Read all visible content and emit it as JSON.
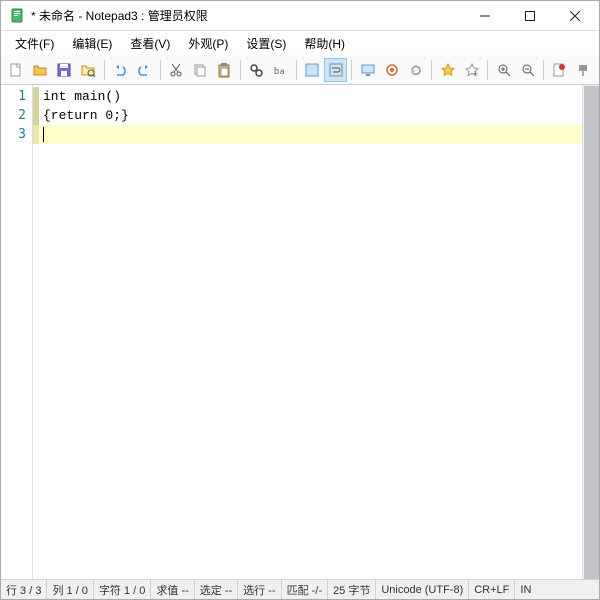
{
  "title": "* 未命名 - Notepad3 : 管理员权限",
  "menu": [
    {
      "label": "文件(F)"
    },
    {
      "label": "编辑(E)"
    },
    {
      "label": "查看(V)"
    },
    {
      "label": "外观(P)"
    },
    {
      "label": "设置(S)"
    },
    {
      "label": "帮助(H)"
    }
  ],
  "code": {
    "lines": [
      {
        "n": "1",
        "text": "int main()"
      },
      {
        "n": "2",
        "text": "{return 0;}"
      },
      {
        "n": "3",
        "text": ""
      }
    ],
    "current_line": 3
  },
  "status": {
    "row": "行 3 / 3",
    "col": "列 1 / 0",
    "char": "字符 1 / 0",
    "eval": "求值  --",
    "sel": "选定  --",
    "sellines": "选行  --",
    "match": "匹配  -/-",
    "bytes": "25 字节",
    "encoding": "Unicode (UTF-8)",
    "eol": "CR+LF",
    "mode": "IN"
  }
}
